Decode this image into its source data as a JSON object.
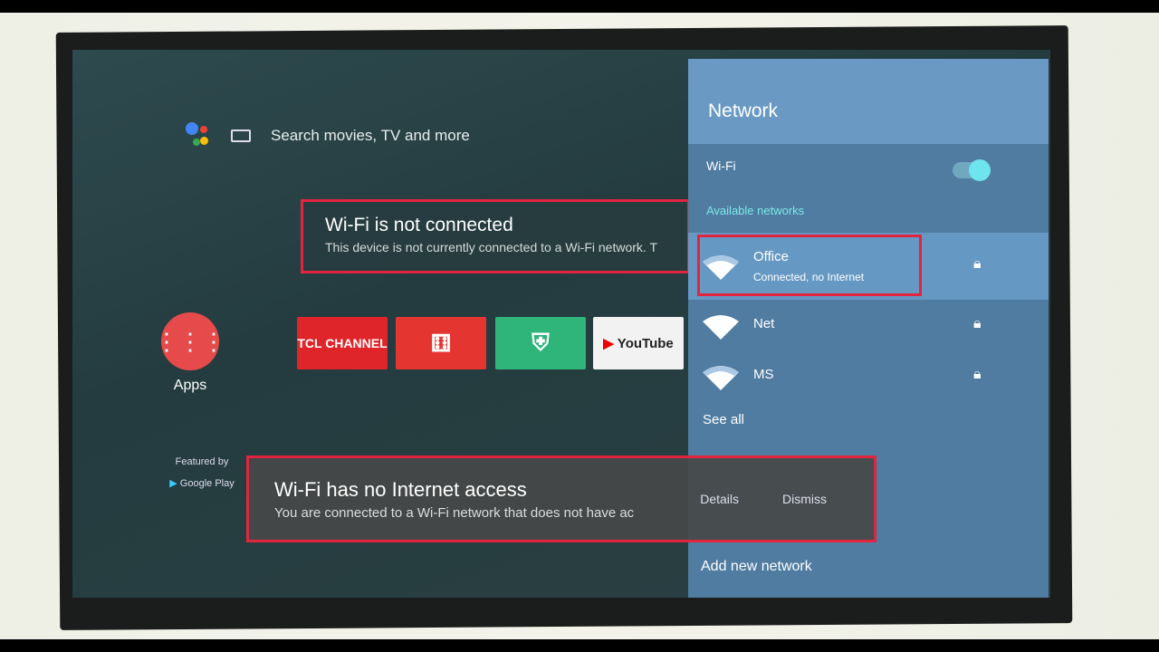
{
  "home": {
    "search_placeholder": "Search movies, TV and more",
    "apps_label": "Apps",
    "featured_by": "Featured by",
    "google_play": "Google Play",
    "tiles": [
      {
        "label": "TCL CHANNEL",
        "color": "#e0252a"
      },
      {
        "label": "",
        "color": "#e53530"
      },
      {
        "label": "",
        "color": "#2fb47a"
      },
      {
        "label": "YouTube",
        "color": "#f2f2f2"
      }
    ]
  },
  "toast_not_connected": {
    "title": "Wi-Fi is not connected",
    "message": "This device is not currently connected to a Wi-Fi network. T"
  },
  "toast_no_internet": {
    "title": "Wi-Fi has no Internet access",
    "message": "You are connected to a Wi-Fi network that does not have ac",
    "details": "Details",
    "dismiss": "Dismiss"
  },
  "network_panel": {
    "title": "Network",
    "wifi_label": "Wi-Fi",
    "wifi_enabled": true,
    "available_networks": "Available networks",
    "networks": [
      {
        "name": "Office",
        "status": "Connected, no Internet",
        "secured": true
      },
      {
        "name": "Net",
        "status": "",
        "secured": true
      },
      {
        "name": "MS",
        "status": "",
        "secured": true
      }
    ],
    "see_all": "See all",
    "add_new_network": "Add new network"
  },
  "colors": {
    "highlight": "#e2243e",
    "accent": "#6ee4ee",
    "panel": "#4f7ca0"
  }
}
